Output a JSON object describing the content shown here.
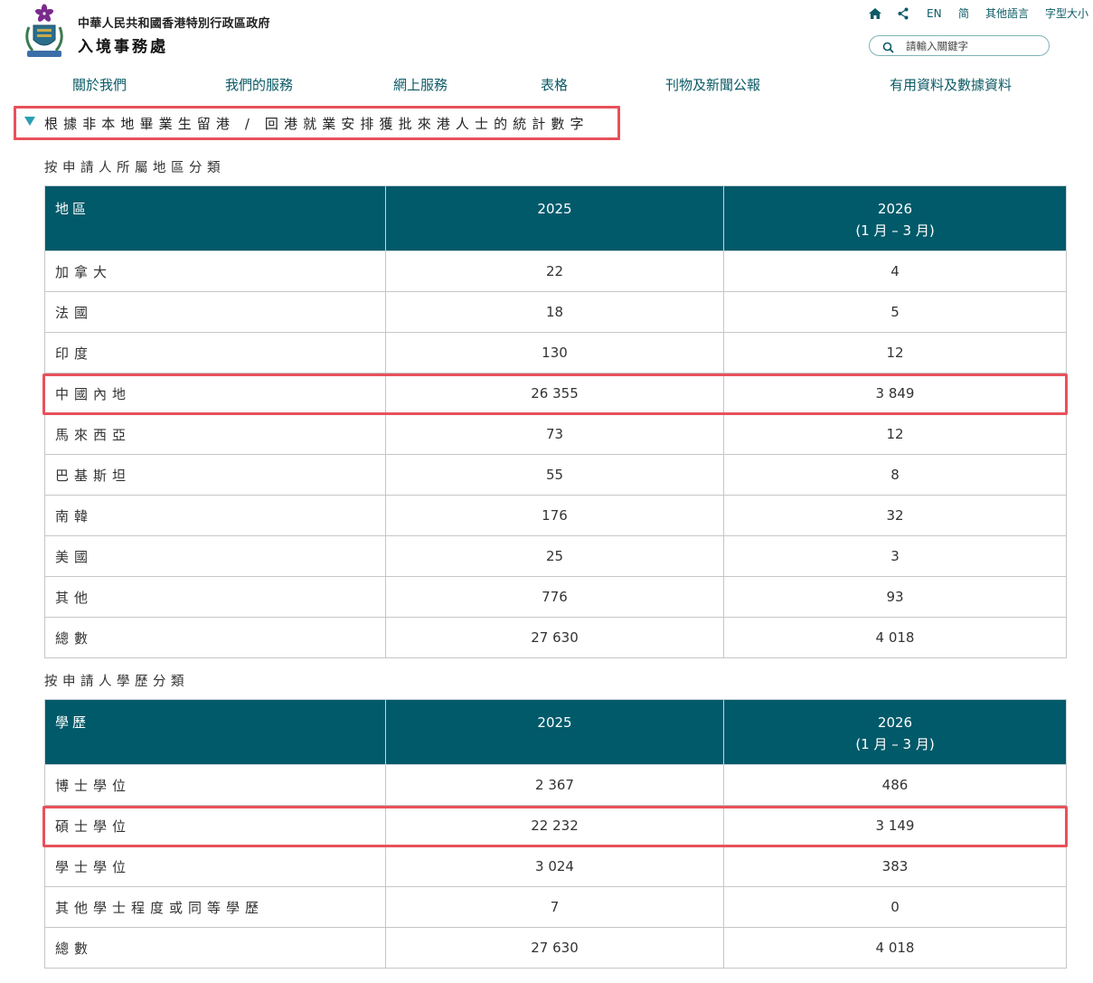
{
  "header": {
    "gov_name": "中華人民共和國香港特別行政區政府",
    "dept_name": "入境事務處",
    "utilities": {
      "home_icon": "home-icon",
      "share_icon": "share-icon",
      "english": "EN",
      "simplified": "简",
      "other_languages": "其他語言",
      "font_size": "字型大小"
    },
    "search": {
      "placeholder": "請輸入關鍵字",
      "icon": "search-icon"
    }
  },
  "nav": {
    "items": [
      {
        "label": "關於我們"
      },
      {
        "label": "我們的服務"
      },
      {
        "label": "網上服務"
      },
      {
        "label": "表格"
      },
      {
        "label": "刊物及新聞公報"
      },
      {
        "label": "有用資料及數據資料"
      }
    ]
  },
  "section": {
    "title": "根據非本地畢業生留港 / 回港就業安排獲批來港人士的統計數字",
    "toggle_icon": "expand-triangle-icon"
  },
  "region_table": {
    "heading": "按申請人所屬地區分類",
    "headers": {
      "col1": "地區",
      "col2": "2025",
      "col3_line1": "2026",
      "col3_line2": "(1 月 – 3 月)"
    },
    "rows": [
      {
        "label": "加拿大",
        "v2025": "22",
        "v2026": "4"
      },
      {
        "label": "法國",
        "v2025": "18",
        "v2026": "5"
      },
      {
        "label": "印度",
        "v2025": "130",
        "v2026": "12"
      },
      {
        "label": "中國內地",
        "v2025": "26 355",
        "v2026": "3 849"
      },
      {
        "label": "馬來西亞",
        "v2025": "73",
        "v2026": "12"
      },
      {
        "label": "巴基斯坦",
        "v2025": "55",
        "v2026": "8"
      },
      {
        "label": "南韓",
        "v2025": "176",
        "v2026": "32"
      },
      {
        "label": "美國",
        "v2025": "25",
        "v2026": "3"
      },
      {
        "label": "其他",
        "v2025": "776",
        "v2026": "93"
      },
      {
        "label": "總數",
        "v2025": "27 630",
        "v2026": "4 018"
      }
    ]
  },
  "education_table": {
    "heading": "按申請人學歷分類",
    "headers": {
      "col1": "學歷",
      "col2": "2025",
      "col3_line1": "2026",
      "col3_line2": "(1 月 – 3 月)"
    },
    "rows": [
      {
        "label": "博士學位",
        "v2025": "2 367",
        "v2026": "486"
      },
      {
        "label": "碩士學位",
        "v2025": "22 232",
        "v2026": "3 149"
      },
      {
        "label": "學士學位",
        "v2025": "3 024",
        "v2026": "383"
      },
      {
        "label": "其他學士程度或同等學歷",
        "v2025": "7",
        "v2026": "0"
      },
      {
        "label": "總數",
        "v2025": "27 630",
        "v2026": "4 018"
      }
    ]
  },
  "colors": {
    "brand_teal": "#005a6a",
    "link_teal": "#0b5a66",
    "highlight_red": "#e8515b",
    "triangle_blue": "#2b9fb1"
  }
}
